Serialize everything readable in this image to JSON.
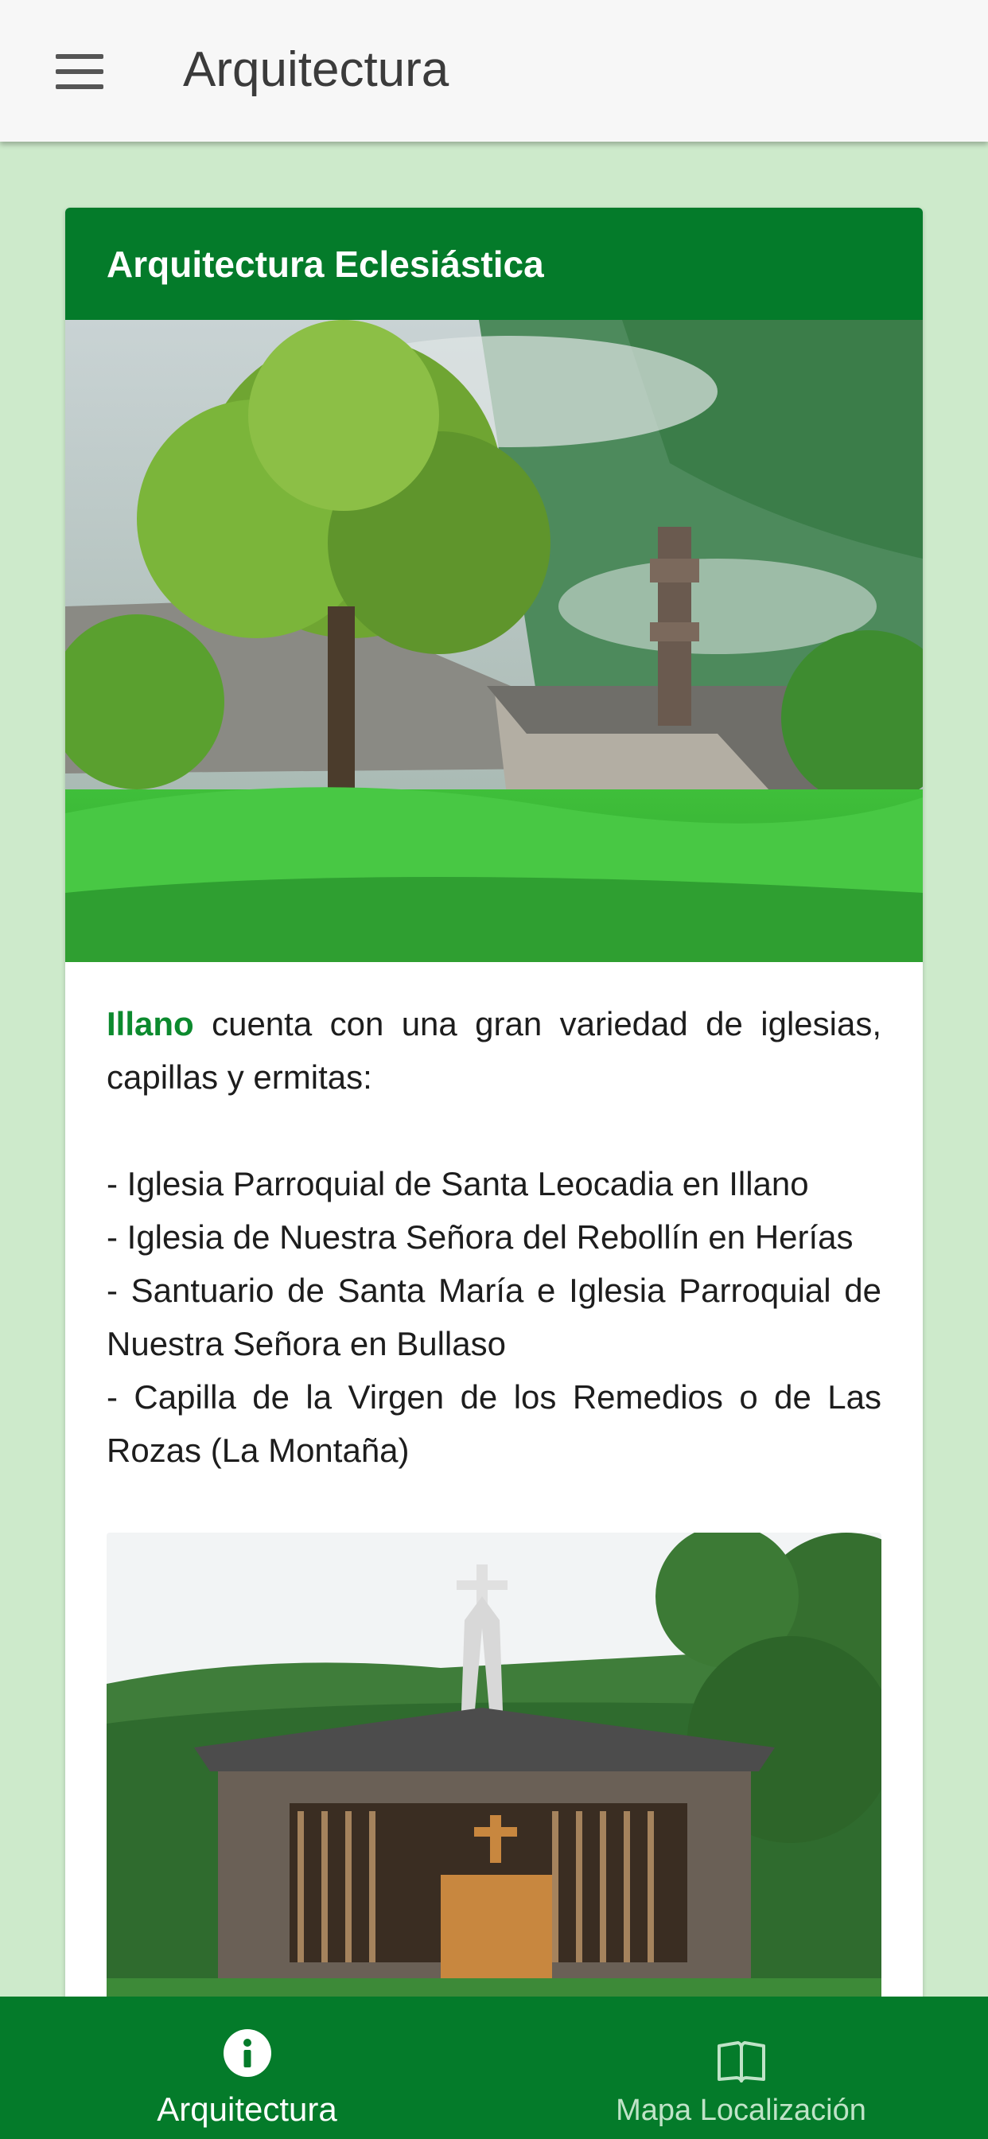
{
  "app_bar": {
    "menu_icon": "hamburger-menu-icon",
    "title": "Arquitectura"
  },
  "card": {
    "title": "Arquitectura Eclesiástica",
    "hero_image_alt": "church-in-misty-valley-photo",
    "intro_highlight": "Illano",
    "intro_rest": " cuenta con una gran variedad de iglesias, capillas y ermitas:",
    "items": [
      "- Iglesia Parroquial de Santa Leocadia en Illano",
      "- Iglesia de Nuestra Señora del Rebollín en Herías",
      "- Santuario de Santa María e Iglesia Parroquial de Nuestra Señora en Bullaso",
      "- Capilla de la Virgen de los Remedios o de Las Rozas (La Montaña)"
    ],
    "second_image_alt": "stone-chapel-with-cross-photo"
  },
  "bottom_nav": {
    "items": [
      {
        "label": "Arquitectura",
        "icon": "info-icon",
        "active": true
      },
      {
        "label": "Mapa Localización",
        "icon": "map-book-icon",
        "active": false
      }
    ]
  },
  "colors": {
    "primary": "#047b2a",
    "highlight": "#0c8a2e",
    "background": "#cdeacb",
    "app_bar": "#f7f7f7"
  }
}
